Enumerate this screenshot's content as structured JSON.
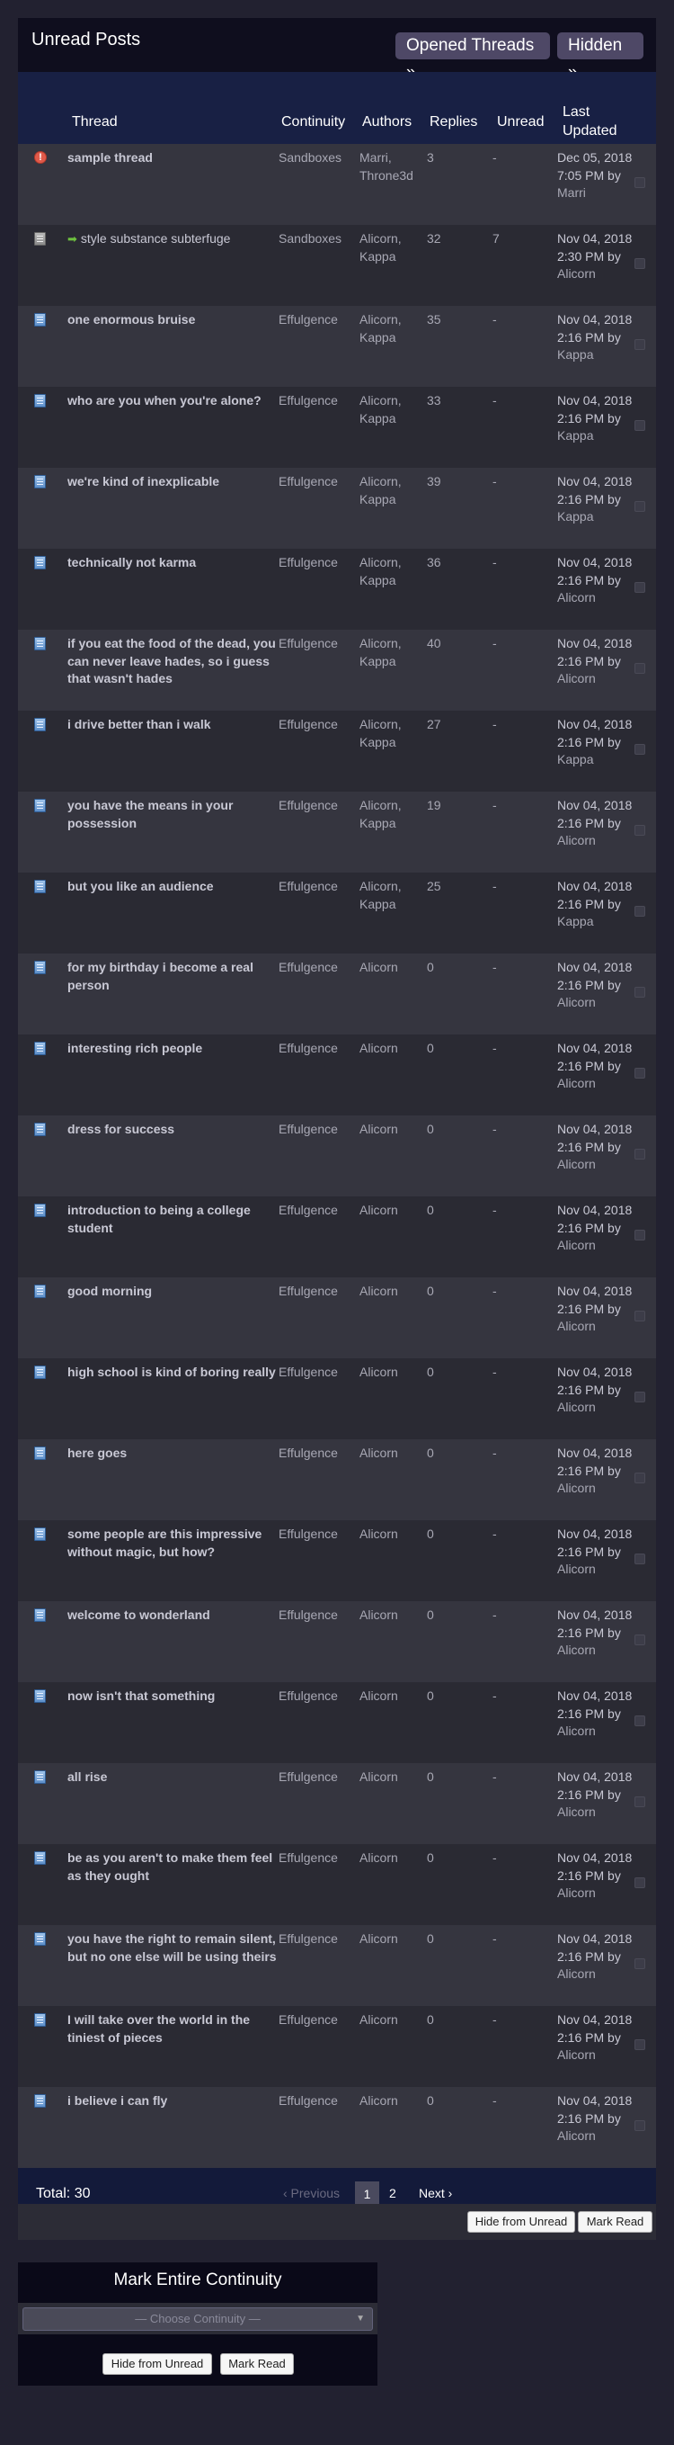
{
  "header": {
    "title": "Unread Posts",
    "opened_threads_label": "Opened Threads »",
    "hidden_label": "Hidden »"
  },
  "columns": {
    "thread": "Thread",
    "continuity": "Continuity",
    "authors": "Authors",
    "replies": "Replies",
    "unread": "Unread",
    "last_updated_1": "Last",
    "last_updated_2": "Updated"
  },
  "rows": [
    {
      "icon": "alert-icon",
      "title": "sample thread",
      "bold": true,
      "continuity": "Sandboxes",
      "authors": "Marri, Throne3d",
      "replies": "3",
      "unread": "-",
      "date": "Dec 05, 2018 7:05 PM by",
      "by": "Marri"
    },
    {
      "icon": "grey-page-icon",
      "new": true,
      "title": "style substance subterfuge",
      "bold": false,
      "continuity": "Sandboxes",
      "authors": "Alicorn, Kappa",
      "replies": "32",
      "unread": "7",
      "date": "Nov 04, 2018 2:30 PM by",
      "by": "Alicorn"
    },
    {
      "icon": "page-icon",
      "title": "one enormous bruise",
      "bold": true,
      "continuity": "Effulgence",
      "authors": "Alicorn, Kappa",
      "replies": "35",
      "unread": "-",
      "date": "Nov 04, 2018 2:16 PM by",
      "by": "Kappa"
    },
    {
      "icon": "page-icon",
      "title": "who are you when you're alone?",
      "bold": true,
      "continuity": "Effulgence",
      "authors": "Alicorn, Kappa",
      "replies": "33",
      "unread": "-",
      "date": "Nov 04, 2018 2:16 PM by",
      "by": "Kappa"
    },
    {
      "icon": "page-icon",
      "title": "we're kind of inexplicable",
      "bold": true,
      "continuity": "Effulgence",
      "authors": "Alicorn, Kappa",
      "replies": "39",
      "unread": "-",
      "date": "Nov 04, 2018 2:16 PM by",
      "by": "Kappa"
    },
    {
      "icon": "page-icon",
      "title": "technically not karma",
      "bold": true,
      "continuity": "Effulgence",
      "authors": "Alicorn, Kappa",
      "replies": "36",
      "unread": "-",
      "date": "Nov 04, 2018 2:16 PM by",
      "by": "Alicorn"
    },
    {
      "icon": "page-icon",
      "title": "if you eat the food of the dead, you can never leave hades, so i guess that wasn't hades",
      "bold": true,
      "continuity": "Effulgence",
      "authors": "Alicorn, Kappa",
      "replies": "40",
      "unread": "-",
      "date": "Nov 04, 2018 2:16 PM by",
      "by": "Alicorn"
    },
    {
      "icon": "page-icon",
      "title": "i drive better than i walk",
      "bold": true,
      "continuity": "Effulgence",
      "authors": "Alicorn, Kappa",
      "replies": "27",
      "unread": "-",
      "date": "Nov 04, 2018 2:16 PM by",
      "by": "Kappa"
    },
    {
      "icon": "page-icon",
      "title": "you have the means in your possession",
      "bold": true,
      "continuity": "Effulgence",
      "authors": "Alicorn, Kappa",
      "replies": "19",
      "unread": "-",
      "date": "Nov 04, 2018 2:16 PM by",
      "by": "Alicorn"
    },
    {
      "icon": "page-icon",
      "title": "but you like an audience",
      "bold": true,
      "continuity": "Effulgence",
      "authors": "Alicorn, Kappa",
      "replies": "25",
      "unread": "-",
      "date": "Nov 04, 2018 2:16 PM by",
      "by": "Kappa"
    },
    {
      "icon": "page-icon",
      "title": "for my birthday i become a real person",
      "bold": true,
      "continuity": "Effulgence",
      "authors": "Alicorn",
      "replies": "0",
      "unread": "-",
      "date": "Nov 04, 2018 2:16 PM by",
      "by": "Alicorn"
    },
    {
      "icon": "page-icon",
      "title": "interesting rich people",
      "bold": true,
      "continuity": "Effulgence",
      "authors": "Alicorn",
      "replies": "0",
      "unread": "-",
      "date": "Nov 04, 2018 2:16 PM by",
      "by": "Alicorn"
    },
    {
      "icon": "page-icon",
      "title": "dress for success",
      "bold": true,
      "continuity": "Effulgence",
      "authors": "Alicorn",
      "replies": "0",
      "unread": "-",
      "date": "Nov 04, 2018 2:16 PM by",
      "by": "Alicorn"
    },
    {
      "icon": "page-icon",
      "title": "introduction to being a college student",
      "bold": true,
      "continuity": "Effulgence",
      "authors": "Alicorn",
      "replies": "0",
      "unread": "-",
      "date": "Nov 04, 2018 2:16 PM by",
      "by": "Alicorn"
    },
    {
      "icon": "page-icon",
      "title": "good morning",
      "bold": true,
      "continuity": "Effulgence",
      "authors": "Alicorn",
      "replies": "0",
      "unread": "-",
      "date": "Nov 04, 2018 2:16 PM by",
      "by": "Alicorn"
    },
    {
      "icon": "page-icon",
      "title": "high school is kind of boring really",
      "bold": true,
      "continuity": "Effulgence",
      "authors": "Alicorn",
      "replies": "0",
      "unread": "-",
      "date": "Nov 04, 2018 2:16 PM by",
      "by": "Alicorn"
    },
    {
      "icon": "page-icon",
      "title": "here goes",
      "bold": true,
      "continuity": "Effulgence",
      "authors": "Alicorn",
      "replies": "0",
      "unread": "-",
      "date": "Nov 04, 2018 2:16 PM by",
      "by": "Alicorn"
    },
    {
      "icon": "page-icon",
      "title": "some people are this impressive without magic, but how?",
      "bold": true,
      "continuity": "Effulgence",
      "authors": "Alicorn",
      "replies": "0",
      "unread": "-",
      "date": "Nov 04, 2018 2:16 PM by",
      "by": "Alicorn"
    },
    {
      "icon": "page-icon",
      "title": "welcome to wonderland",
      "bold": true,
      "continuity": "Effulgence",
      "authors": "Alicorn",
      "replies": "0",
      "unread": "-",
      "date": "Nov 04, 2018 2:16 PM by",
      "by": "Alicorn"
    },
    {
      "icon": "page-icon",
      "title": "now isn't that something",
      "bold": true,
      "continuity": "Effulgence",
      "authors": "Alicorn",
      "replies": "0",
      "unread": "-",
      "date": "Nov 04, 2018 2:16 PM by",
      "by": "Alicorn"
    },
    {
      "icon": "page-icon",
      "title": "all rise",
      "bold": true,
      "continuity": "Effulgence",
      "authors": "Alicorn",
      "replies": "0",
      "unread": "-",
      "date": "Nov 04, 2018 2:16 PM by",
      "by": "Alicorn"
    },
    {
      "icon": "page-icon",
      "title": "be as you aren't to make them feel as they ought",
      "bold": true,
      "continuity": "Effulgence",
      "authors": "Alicorn",
      "replies": "0",
      "unread": "-",
      "date": "Nov 04, 2018 2:16 PM by",
      "by": "Alicorn"
    },
    {
      "icon": "page-icon",
      "title": "you have the right to remain silent, but no one else will be using theirs",
      "bold": true,
      "continuity": "Effulgence",
      "authors": "Alicorn",
      "replies": "0",
      "unread": "-",
      "date": "Nov 04, 2018 2:16 PM by",
      "by": "Alicorn"
    },
    {
      "icon": "page-icon",
      "title": "I will take over the world in the tiniest of pieces",
      "bold": true,
      "continuity": "Effulgence",
      "authors": "Alicorn",
      "replies": "0",
      "unread": "-",
      "date": "Nov 04, 2018 2:16 PM by",
      "by": "Alicorn"
    },
    {
      "icon": "page-icon",
      "title": "i believe i can fly",
      "bold": true,
      "continuity": "Effulgence",
      "authors": "Alicorn",
      "replies": "0",
      "unread": "-",
      "date": "Nov 04, 2018 2:16 PM by",
      "by": "Alicorn"
    }
  ],
  "footer": {
    "total": "Total: 30",
    "previous": "‹ Previous",
    "page1": "1",
    "page2": "2",
    "next": "Next ›"
  },
  "actions": {
    "hide_from_unread": "Hide from Unread",
    "mark_read": "Mark Read"
  },
  "continuity_box": {
    "title": "Mark Entire Continuity",
    "select_placeholder": "— Choose Continuity —",
    "hide_from_unread": "Hide from Unread",
    "mark_read": "Mark Read"
  }
}
